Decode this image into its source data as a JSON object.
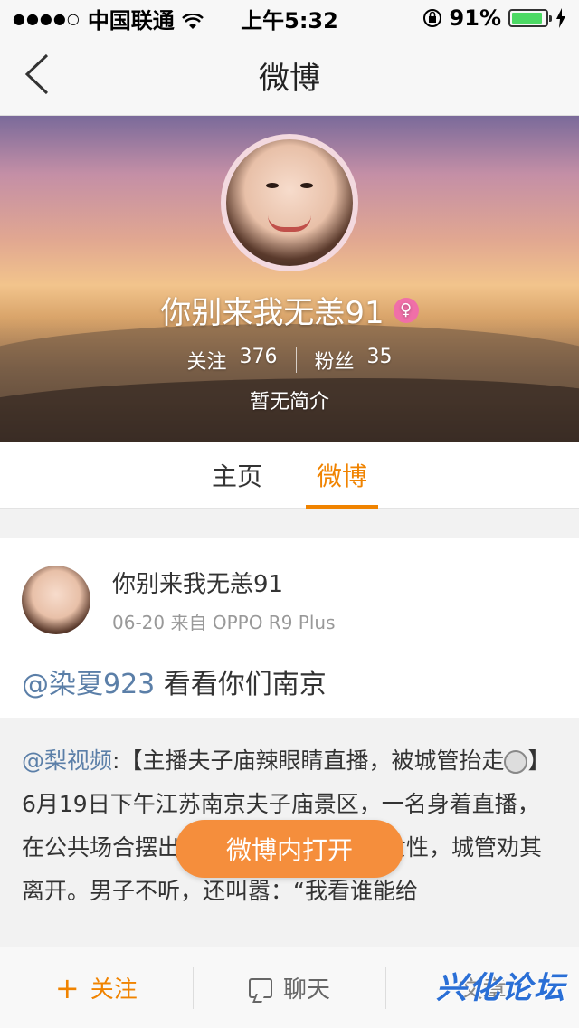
{
  "status_bar": {
    "signal": "●●●●○",
    "carrier": "中国联通",
    "time": "上午5:32",
    "battery_percent": "91%",
    "battery_level": 0.91
  },
  "nav": {
    "title": "微博"
  },
  "profile": {
    "name": "你别来我无恙91",
    "following_label": "关注",
    "following_count": "376",
    "followers_label": "粉丝",
    "followers_count": "35",
    "bio": "暂无简介"
  },
  "tabs": [
    {
      "label": "主页"
    },
    {
      "label": "微博"
    }
  ],
  "post": {
    "author": "你别来我无恙91",
    "meta": "06-20 来自 OPPO R9 Plus",
    "mention": "@染夏923",
    "text": " 看看你们南京",
    "repost": {
      "mention": "@梨视频",
      "text_part1": ":【主播夫子庙辣眼睛直播，被城管抬走",
      "text_part2": "】6月19日下午江苏南京夫子庙景区，一名身着",
      "text_part3": "直播，在公共场合摆出不雅动作还骚扰路过女性，城管劝其离开。男子不听，还叫嚣：“我看谁能给"
    }
  },
  "open_button": "微博内打开",
  "bottom_bar": {
    "follow": "关注",
    "chat": "聊天",
    "third": "文章"
  },
  "watermark": "兴化论坛",
  "colors": {
    "accent": "#f08300",
    "link": "#5b7fa8",
    "open_button": "#f58e3c"
  }
}
